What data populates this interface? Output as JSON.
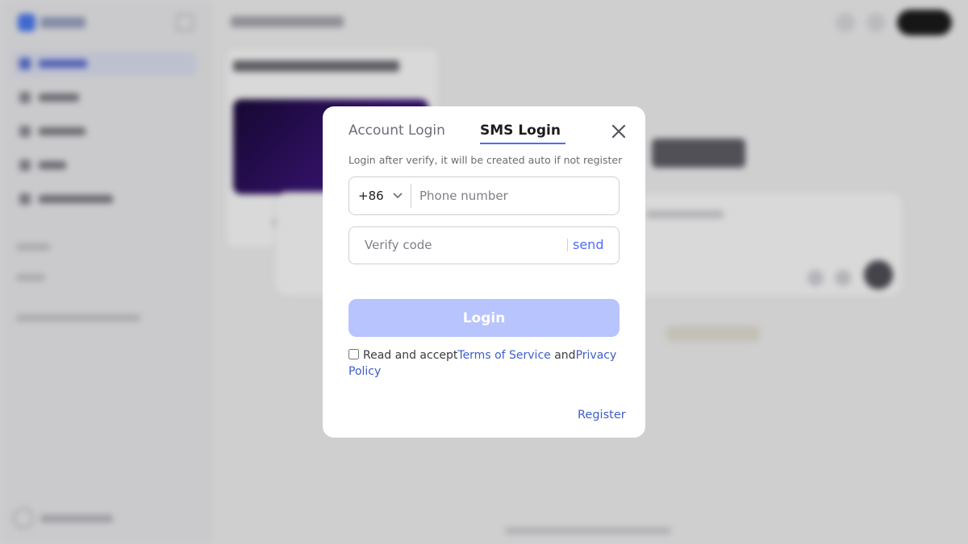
{
  "modal": {
    "tabs": {
      "account": "Account Login",
      "sms": "SMS Login"
    },
    "hint": "Login after verify, it will be created auto if not register",
    "country_code": "+86",
    "phone_placeholder": "Phone number",
    "code_placeholder": "Verify code",
    "send_label": "send",
    "login_label": "Login",
    "agreement": {
      "prefix": "Read and accept",
      "terms": "Terms of Service",
      "and": "and",
      "privacy": "Privacy Policy"
    },
    "register_label": "Register"
  },
  "colors": {
    "accent": "#4d6bfe",
    "login_button_disabled": "#b8c4fd",
    "link": "#3d5ec7"
  },
  "icons": {
    "close": "close-icon",
    "dropdown": "chevron-down-icon"
  }
}
